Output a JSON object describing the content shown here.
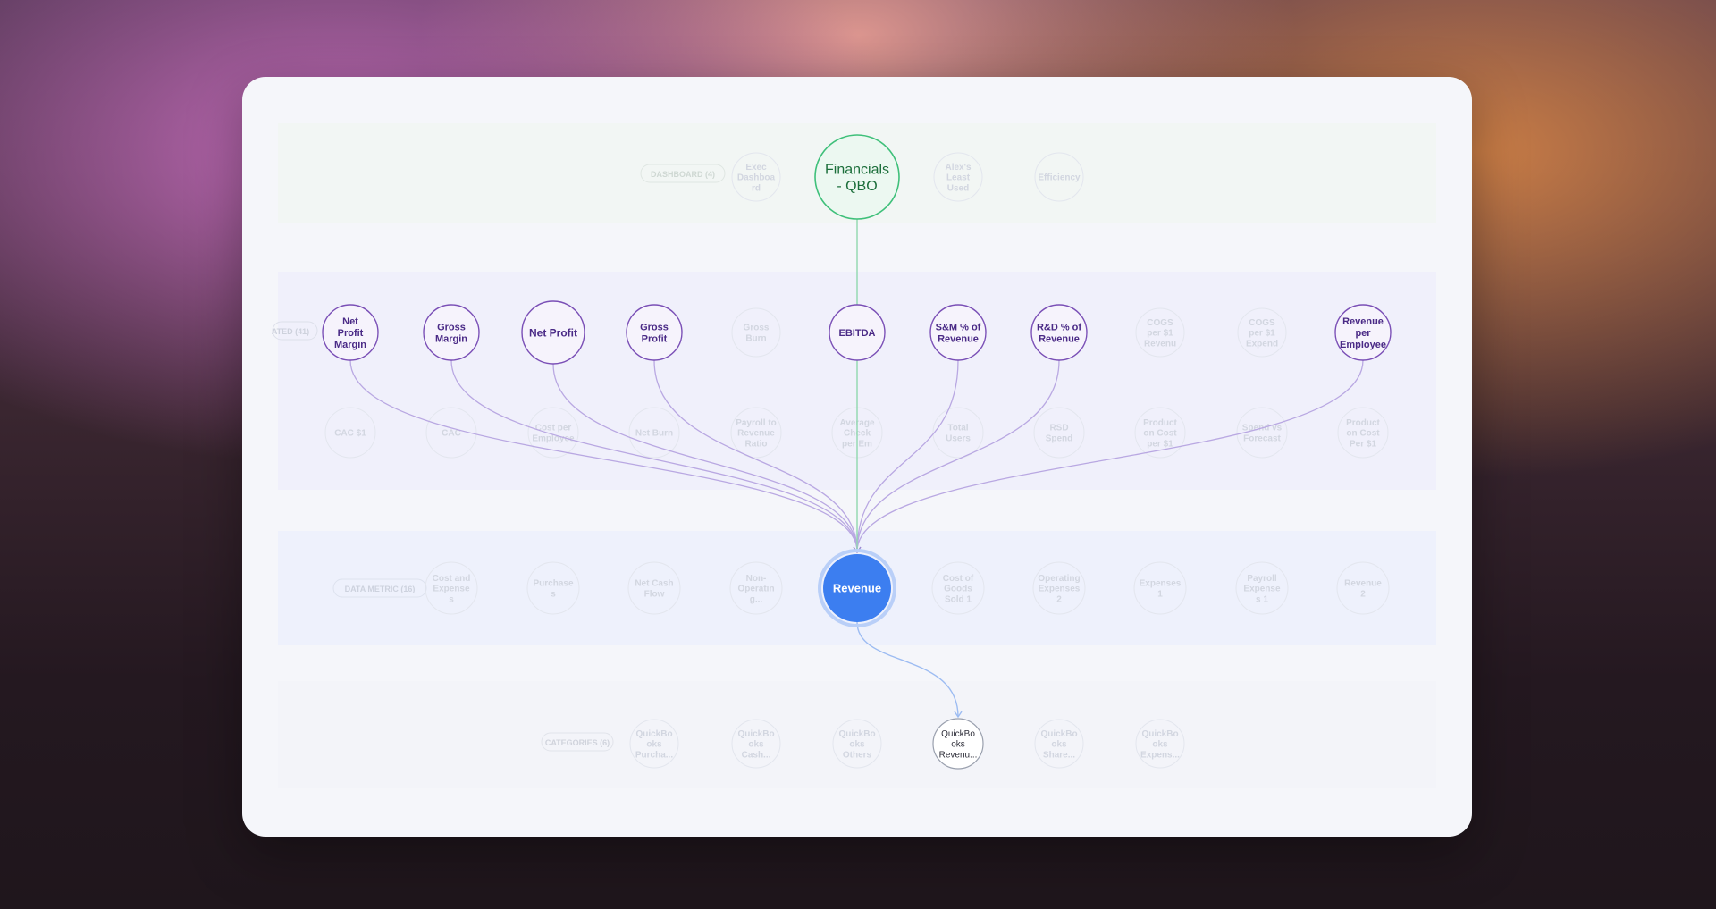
{
  "colors": {
    "primary": "#3c7ef0",
    "metric": "#7a4fb6",
    "metric_text": "#4a2a86",
    "source": "#3fc07a",
    "source_text": "#1b6e3a",
    "data_text": "#2f2f3a",
    "faded": "#cfd3de"
  },
  "diagram": {
    "source_node": {
      "label_lines": [
        "Financials",
        "- QBO"
      ]
    },
    "center_node": {
      "label_lines": [
        "Revenue"
      ]
    },
    "metrics": [
      {
        "label_lines": [
          "Net",
          "Profit",
          "Margin"
        ]
      },
      {
        "label_lines": [
          "Gross",
          "Margin"
        ]
      },
      {
        "label_lines": [
          "Net Profit"
        ]
      },
      {
        "label_lines": [
          "Gross",
          "Profit"
        ]
      },
      {
        "label_lines": [
          "EBITDA"
        ]
      },
      {
        "label_lines": [
          "S&M % of",
          "Revenue"
        ]
      },
      {
        "label_lines": [
          "R&D % of",
          "Revenue"
        ]
      },
      {
        "label_lines": [
          "Revenue",
          "per",
          "Employee"
        ]
      }
    ],
    "data_node": {
      "label_lines": [
        "QuickBo",
        "oks",
        "Revenu..."
      ]
    },
    "background": {
      "row1_labels": [
        {
          "lines": [
            "Exec",
            "Dashboa",
            "rd"
          ]
        },
        {
          "lines": [
            "Alex's",
            "Least",
            "Used"
          ]
        },
        {
          "lines": [
            "Efficiency"
          ]
        }
      ],
      "row1_pill": "DASHBOARD (4)",
      "row2_pill": "ATED (41)",
      "row2_labels": [
        {
          "lines": [
            "Gross",
            "Burn"
          ]
        },
        {
          "lines": [
            "COGS",
            "per $1",
            "Revenu"
          ]
        },
        {
          "lines": [
            "COGS",
            "per $1",
            "Expend"
          ]
        }
      ],
      "row3_labels": [
        {
          "lines": [
            "CAC $1"
          ]
        },
        {
          "lines": [
            "CAC"
          ]
        },
        {
          "lines": [
            "Cost per",
            "Employee"
          ]
        },
        {
          "lines": [
            "Net Burn"
          ]
        },
        {
          "lines": [
            "Payroll to",
            "Revenue",
            "Ratio"
          ]
        },
        {
          "lines": [
            "Average",
            "Check",
            "per Em"
          ]
        },
        {
          "lines": [
            "Total",
            "Users"
          ]
        },
        {
          "lines": [
            "RSD",
            "Spend"
          ]
        },
        {
          "lines": [
            "Product",
            "on Cost",
            "per $1"
          ]
        },
        {
          "lines": [
            "Spend vs",
            "Forecast"
          ]
        },
        {
          "lines": [
            "Product",
            "on Cost",
            "Per $1"
          ]
        }
      ],
      "row4_pill": "DATA METRIC (16)",
      "row4_labels": [
        {
          "lines": [
            "Cost and",
            "Expense",
            "s"
          ]
        },
        {
          "lines": [
            "Purchase",
            "s"
          ]
        },
        {
          "lines": [
            "Net Cash",
            "Flow"
          ]
        },
        {
          "lines": [
            "Non-",
            "Operatin",
            "g..."
          ]
        },
        {
          "lines": [
            "Cost of",
            "Goods",
            "Sold 1"
          ]
        },
        {
          "lines": [
            "Operating",
            "Expenses",
            "2"
          ]
        },
        {
          "lines": [
            "Expenses",
            "1"
          ]
        },
        {
          "lines": [
            "Payroll",
            "Expense",
            "s 1"
          ]
        },
        {
          "lines": [
            "Revenue",
            "2"
          ]
        }
      ],
      "row5_pill": "CATEGORIES (6)",
      "row5_labels": [
        {
          "lines": [
            "QuickBo",
            "oks",
            "Purcha..."
          ]
        },
        {
          "lines": [
            "QuickBo",
            "oks",
            "Cash..."
          ]
        },
        {
          "lines": [
            "QuickBo",
            "oks",
            "Others"
          ]
        },
        {
          "lines": [
            "QuickBo",
            "oks",
            "Share..."
          ]
        },
        {
          "lines": [
            "QuickBo",
            "oks",
            "Expens..."
          ]
        }
      ]
    }
  }
}
